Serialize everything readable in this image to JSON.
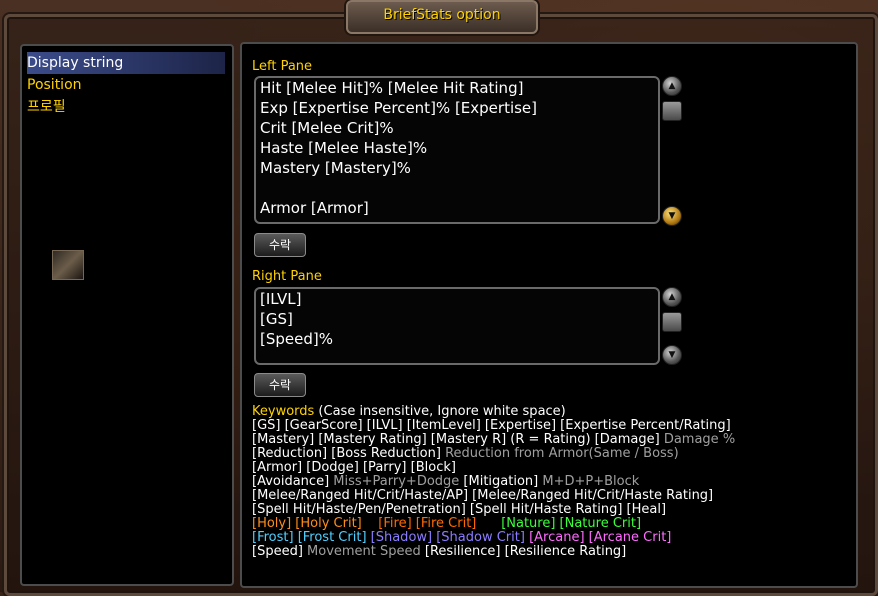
{
  "window": {
    "title": "BriefStats option"
  },
  "sidebar": {
    "items": [
      {
        "label": "Display string",
        "selected": true
      },
      {
        "label": "Position",
        "selected": false
      },
      {
        "label": "프로필",
        "selected": false
      }
    ]
  },
  "left_pane": {
    "label": "Left Pane",
    "lines": [
      "Hit [Melee Hit]% [Melee Hit Rating]",
      "Exp [Expertise Percent]% [Expertise]",
      "Crit [Melee Crit]%",
      "Haste [Melee Haste]%",
      "Mastery [Mastery]%",
      "",
      "Armor [Armor]"
    ],
    "accept_label": "수락"
  },
  "right_pane": {
    "label": "Right Pane",
    "lines": [
      "[ILVL]",
      "[GS]",
      "[Speed]%"
    ],
    "accept_label": "수락"
  },
  "keywords": {
    "heading": "Keywords",
    "heading_note": " (Case insensitive, Ignore white space)",
    "row1": "[GS]  [GearScore]  [ILVL]  [ItemLevel]    [Expertise]  [Expertise Percent/Rating]",
    "row2a": "[Mastery]  [Mastery Rating]  [Mastery R] (R = Rating)  [Damage] ",
    "row2b": "Damage %",
    "row3a": "[Reduction]  [Boss Reduction] ",
    "row3b": "Reduction from Armor(Same / Boss)",
    "row4": "[Armor]  [Dodge]  [Parry]  [Block]",
    "row5a": "[Avoidance] ",
    "row5b": "Miss+Parry+Dodge",
    "row5c": "  [Mitigation] ",
    "row5d": "M+D+P+Block",
    "row6": "[Melee/Ranged Hit/Crit/Haste/AP]  [Melee/Ranged Hit/Crit/Haste Rating]",
    "row7": "[Spell Hit/Haste/Pen/Penetration] [Spell Hit/Haste Rating] [Heal]",
    "holy": "[Holy] [Holy Crit]",
    "fire": "[Fire] [Fire Crit]",
    "nature": "[Nature] [Nature Crit]",
    "frost": "[Frost] [Frost Crit]",
    "shadow": "[Shadow] [Shadow Crit]",
    "arcane": "[Arcane] [Arcane Crit]",
    "row10a": "[Speed] ",
    "row10b": "Movement Speed",
    "row10c": "  [Resilience]  [Resilience Rating]"
  },
  "colors": {
    "gold": "#ffd200",
    "holy": "#ff8c1a",
    "fire": "#ff6a00",
    "nature": "#3cff3c",
    "frost": "#4fd0ff",
    "shadow": "#8c7cff",
    "arcane": "#ff6cff"
  }
}
